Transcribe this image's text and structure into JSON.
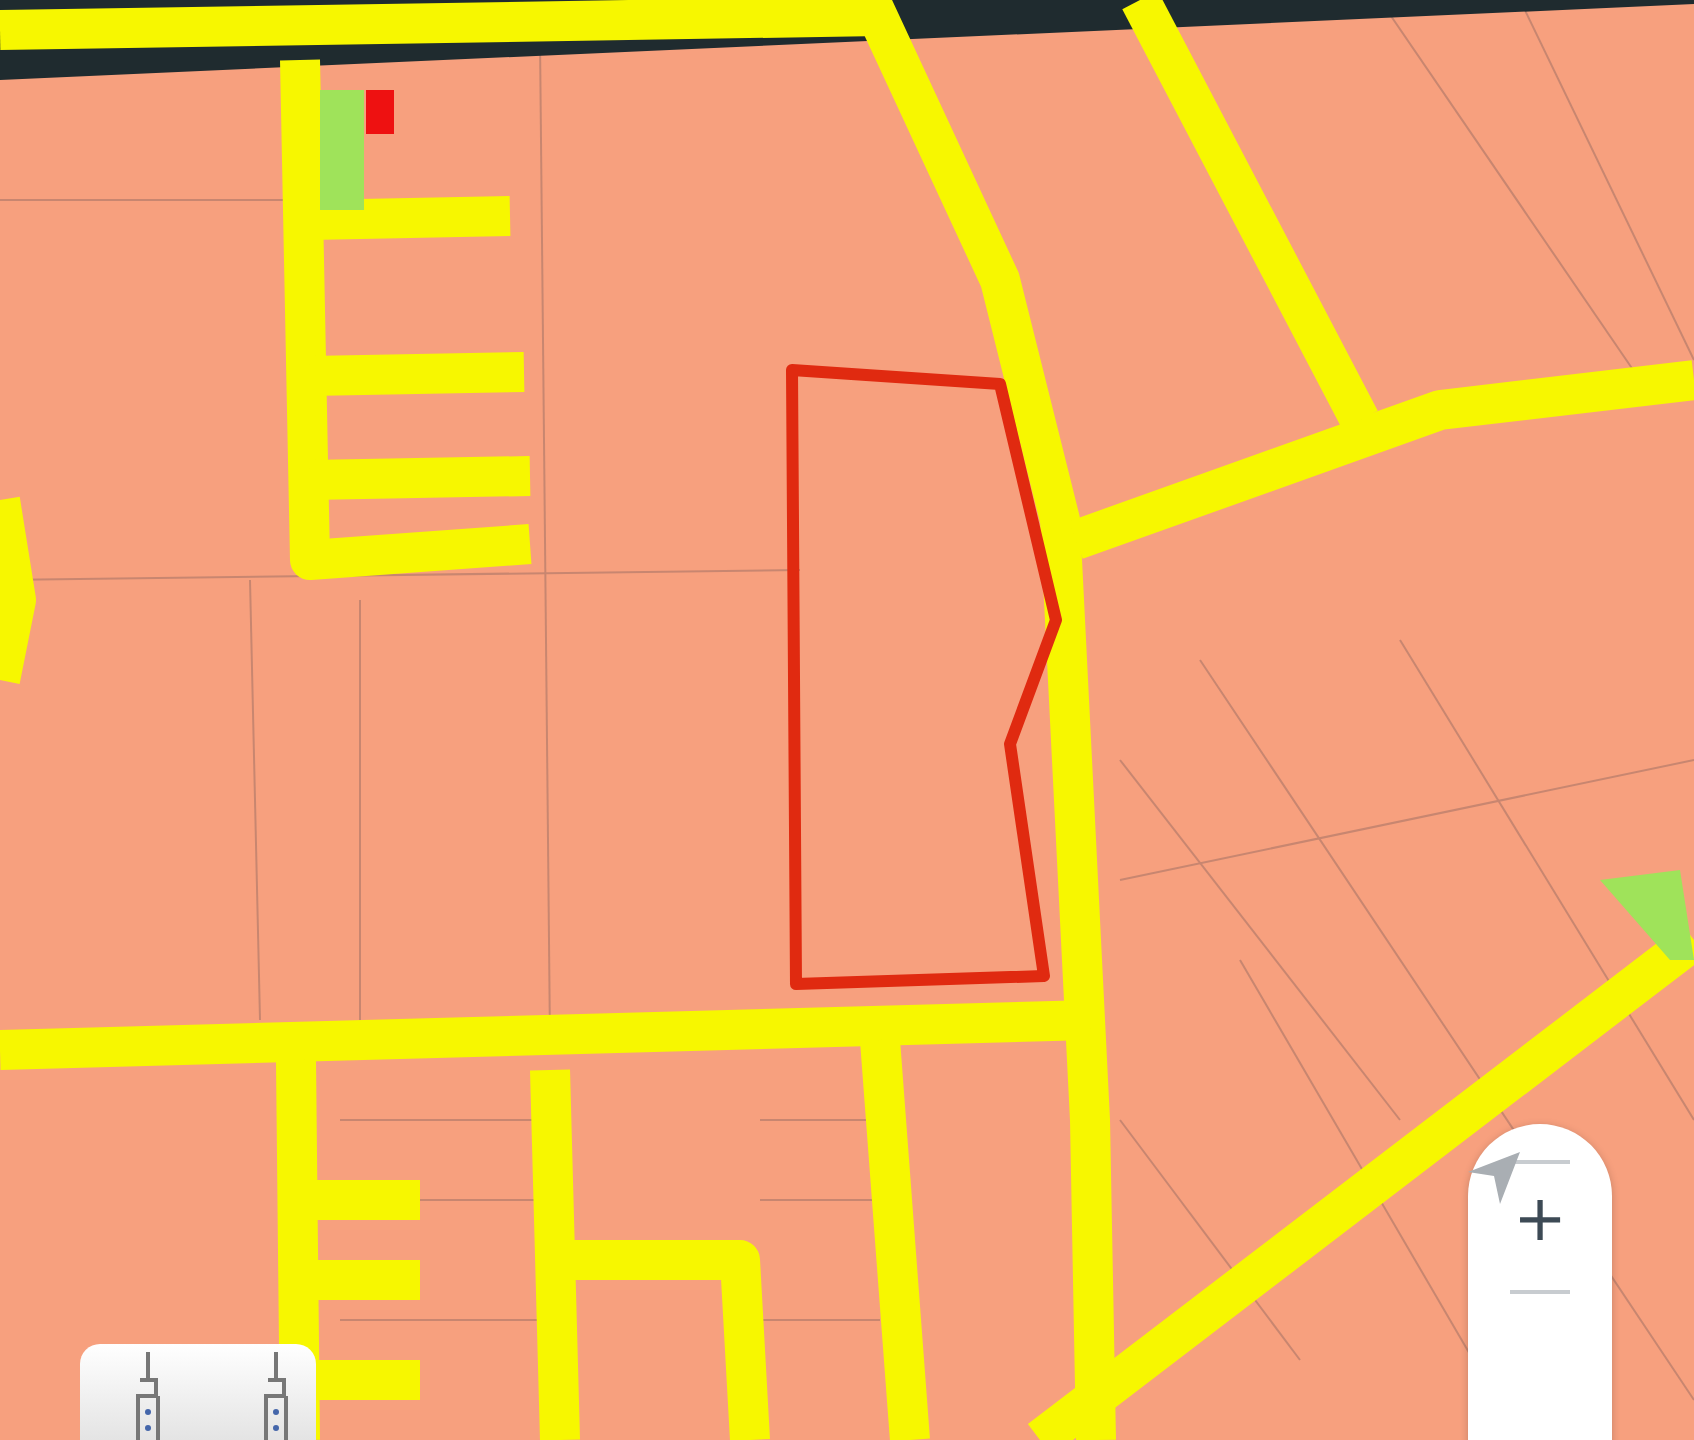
{
  "map_controls": {
    "zoom_in": {
      "label": "+"
    }
  }
}
